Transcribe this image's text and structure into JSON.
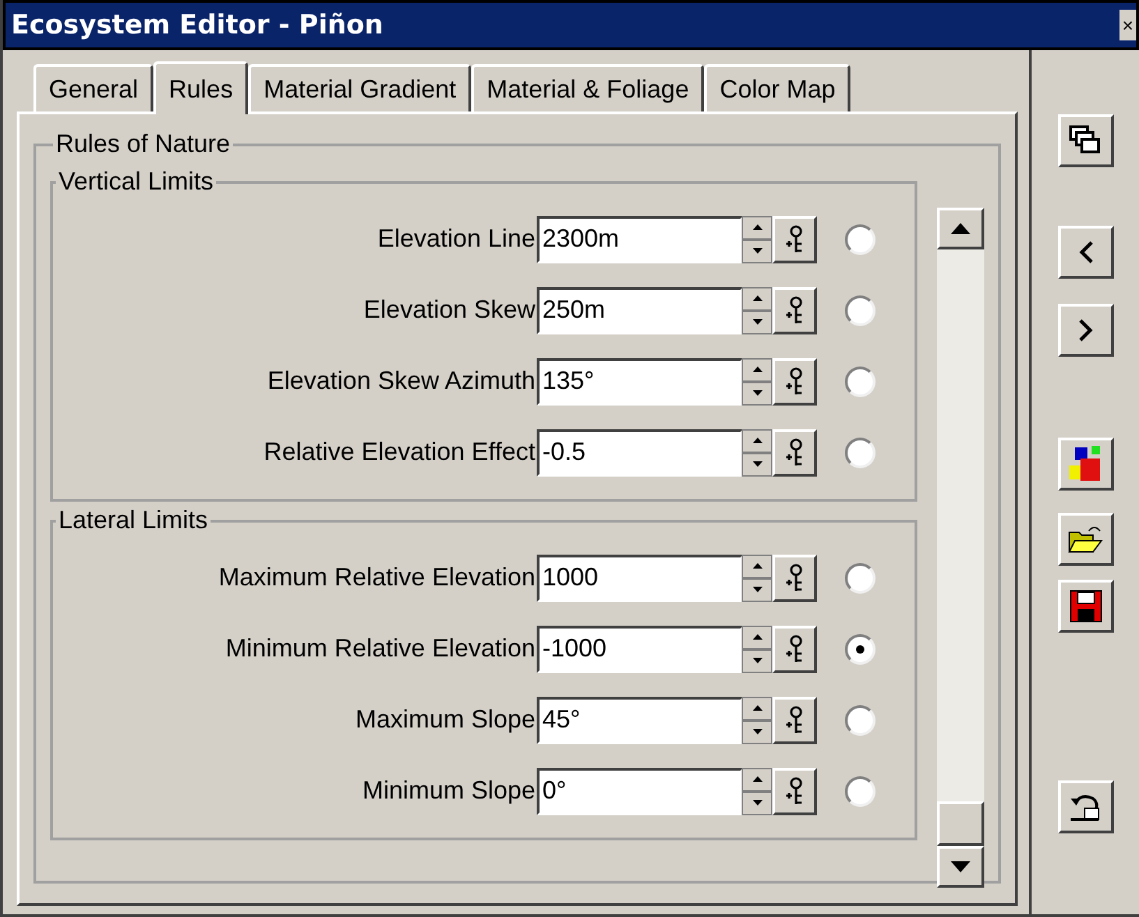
{
  "window": {
    "title": "Ecosystem Editor - Piñon",
    "close": "×"
  },
  "tabs": [
    {
      "label": "General",
      "selected": false
    },
    {
      "label": "Rules",
      "selected": true
    },
    {
      "label": "Material Gradient",
      "selected": false
    },
    {
      "label": "Material & Foliage",
      "selected": false
    },
    {
      "label": "Color Map",
      "selected": false
    }
  ],
  "group": {
    "title": "Rules of Nature",
    "sections": [
      {
        "title": "Vertical Limits",
        "rows": [
          {
            "label": "Elevation Line",
            "value": "2300m",
            "selected": false
          },
          {
            "label": "Elevation Skew",
            "value": "250m",
            "selected": false
          },
          {
            "label": "Elevation Skew Azimuth",
            "value": "135°",
            "selected": false
          },
          {
            "label": "Relative Elevation Effect",
            "value": "-0.5",
            "selected": false
          }
        ]
      },
      {
        "title": "Lateral Limits",
        "rows": [
          {
            "label": "Maximum Relative Elevation",
            "value": "1000",
            "selected": false
          },
          {
            "label": "Minimum Relative Elevation",
            "value": "-1000",
            "selected": true
          },
          {
            "label": "Maximum Slope",
            "value": "45°",
            "selected": false
          },
          {
            "label": "Minimum Slope",
            "value": "0°",
            "selected": false
          }
        ]
      }
    ]
  }
}
